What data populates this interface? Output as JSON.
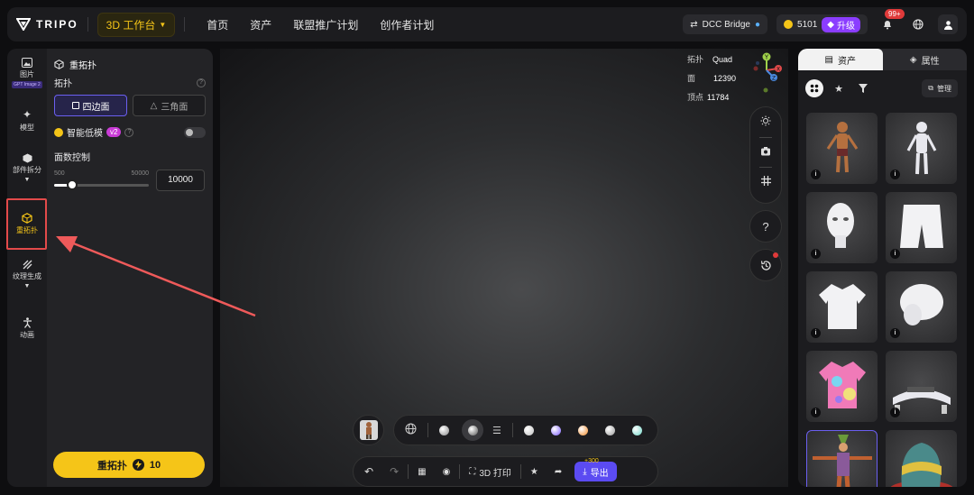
{
  "app": {
    "logo_text": "TRIPO",
    "workbench_label": "3D 工作台"
  },
  "nav": [
    "首页",
    "资产",
    "联盟推广计划",
    "创作者计划"
  ],
  "topbar": {
    "dcc_label": "DCC Bridge",
    "credits": "5101",
    "upgrade_label": "升级",
    "notif_count": "99+"
  },
  "rail": {
    "items": [
      {
        "label": "图片",
        "icon": "image-icon",
        "badge": "GPT Image 2"
      },
      {
        "label": "模型",
        "icon": "sparkle-icon"
      },
      {
        "label": "部件拆分",
        "icon": "cube-icon"
      },
      {
        "label": "重拓扑",
        "icon": "retopology-icon"
      },
      {
        "label": "纹理生成",
        "icon": "texture-icon"
      },
      {
        "label": "动画",
        "icon": "figure-icon"
      }
    ]
  },
  "panel": {
    "title": "重拓扑",
    "topology_label": "拓扑",
    "quad_label": "四边面",
    "tri_label": "三角面",
    "smart_low_label": "智能低模",
    "smart_low_version": "v2",
    "face_control_label": "面数控制",
    "slider_min": "500",
    "slider_max": "50000",
    "face_count": "10000",
    "slider_fraction": 0.192,
    "cta_label": "重拓扑",
    "cta_cost": "10"
  },
  "stats": {
    "topology_label": "拓扑",
    "topology_value": "Quad",
    "faces_label": "面",
    "faces_value": "12390",
    "vertices_label": "顶点",
    "vertices_value": "11784"
  },
  "gizmo": {
    "y": "Y",
    "x": "X",
    "z": "Z"
  },
  "viewport_tools": {
    "help": "?"
  },
  "bottom_bar": {
    "print_label": "3D 打印",
    "export_label": "导出",
    "bonus": "+300"
  },
  "material_colors": [
    "#d9d9d9",
    "#bfbfbf",
    "#7b5cff",
    "#f08a2a",
    "#9a9a9a",
    "#6fd6c8"
  ],
  "right_panel": {
    "tab_assets": "资产",
    "tab_properties": "属性",
    "manage_label": "管理",
    "info_glyph": "i",
    "assets": [
      "character-icon",
      "white-figure-icon",
      "head-icon",
      "shorts-icon",
      "shirt-icon",
      "hair-icon",
      "hawaiian-shirt-icon",
      "console-icon",
      "clown-icon",
      "hat-icon"
    ]
  },
  "accent": "#f5c518",
  "brand_purple": "#5b4bf2"
}
